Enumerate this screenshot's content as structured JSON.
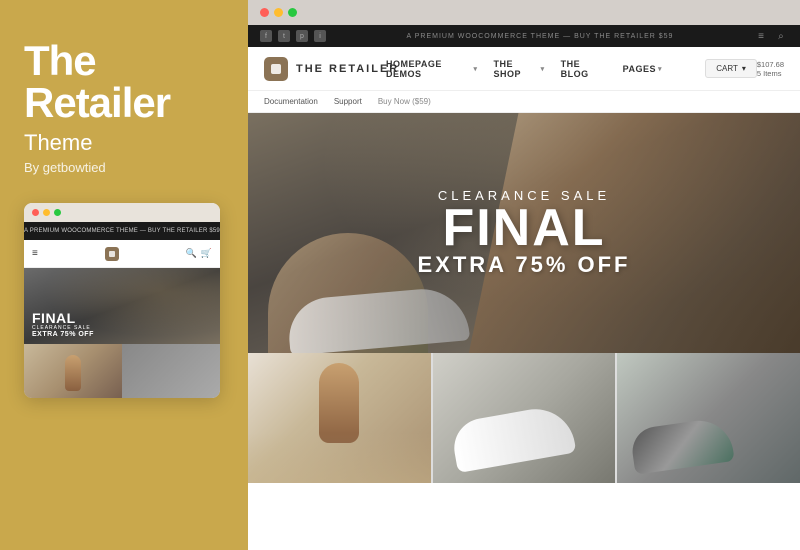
{
  "left": {
    "title_line1": "The",
    "title_line2": "Retailer",
    "subtitle": "Theme",
    "byline": "By getbowtied"
  },
  "mini_browser": {
    "topbar_text": "A PREMIUM WOOCOMMERCE THEME — BUY THE RETAILER $59",
    "hero": {
      "final": "FINAL",
      "clearance": "CLEARANCE SALE",
      "extra": "EXTRA 75% OFF"
    }
  },
  "main_browser": {
    "topbar": {
      "promo_text": "A PREMIUM WOOCOMMERCE THEME — BUY THE RETAILER $59"
    },
    "navbar": {
      "logo_text": "THE RETAILER",
      "nav_items": [
        {
          "label": "HOMEPAGE DEMOS",
          "has_arrow": true
        },
        {
          "label": "THE SHOP",
          "has_arrow": true
        },
        {
          "label": "THE BLOG",
          "has_arrow": false
        },
        {
          "label": "PAGES",
          "has_arrow": true
        }
      ],
      "cart_label": "CART",
      "cart_amount": "$107.68",
      "cart_items": "5 Items"
    },
    "subnav": {
      "items": [
        "Documentation",
        "Support",
        "Buy Now ($59)"
      ]
    },
    "hero": {
      "final": "FINAL",
      "clearance": "CLEARANCE SALE",
      "extra": "EXTRA 75% OFF"
    }
  }
}
